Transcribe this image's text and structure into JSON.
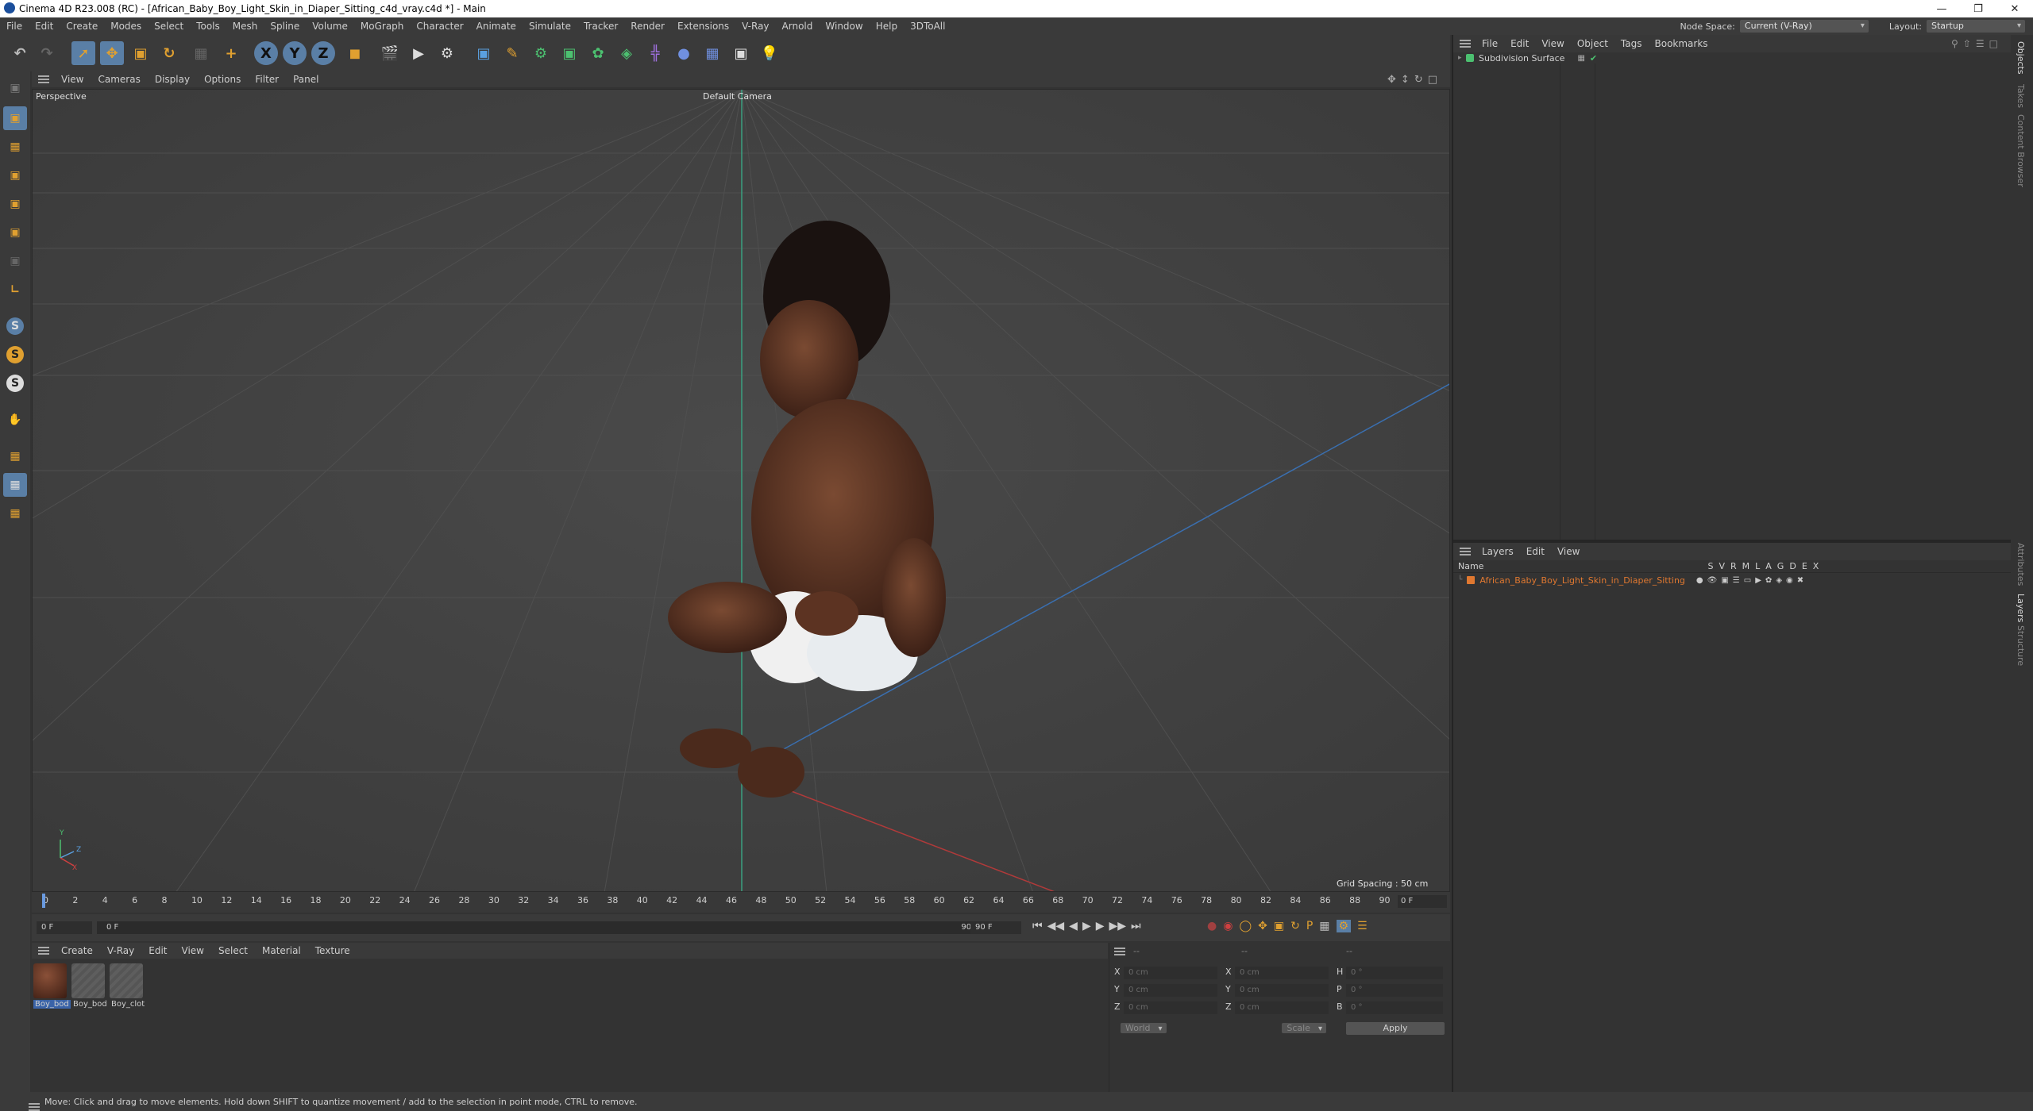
{
  "window": {
    "title": "Cinema 4D R23.008 (RC) - [African_Baby_Boy_Light_Skin_in_Diaper_Sitting_c4d_vray.c4d *] - Main"
  },
  "menubar": {
    "items": [
      "File",
      "Edit",
      "Create",
      "Modes",
      "Select",
      "Tools",
      "Mesh",
      "Spline",
      "Volume",
      "MoGraph",
      "Character",
      "Animate",
      "Simulate",
      "Tracker",
      "Render",
      "Extensions",
      "V-Ray",
      "Arnold",
      "Window",
      "Help",
      "3DToAll"
    ],
    "node_space_label": "Node Space:",
    "node_space_value": "Current (V-Ray)",
    "layout_label": "Layout:",
    "layout_value": "Startup"
  },
  "viewport": {
    "menu": [
      "View",
      "Cameras",
      "Display",
      "Options",
      "Filter",
      "Panel"
    ],
    "mode_label": "Perspective",
    "camera_label": "Default Camera",
    "grid_spacing": "Grid Spacing : 50 cm",
    "axis_labels": {
      "y": "Y",
      "z": "Z",
      "x": "X"
    }
  },
  "timeline": {
    "ticks": [
      "0",
      "2",
      "4",
      "6",
      "8",
      "10",
      "12",
      "14",
      "16",
      "18",
      "20",
      "22",
      "24",
      "26",
      "28",
      "30",
      "32",
      "34",
      "36",
      "38",
      "40",
      "42",
      "44",
      "46",
      "48",
      "50",
      "52",
      "54",
      "56",
      "58",
      "60",
      "62",
      "64",
      "66",
      "68",
      "70",
      "72",
      "74",
      "76",
      "78",
      "80",
      "82",
      "84",
      "86",
      "88",
      "90"
    ],
    "end_frame_field": "0 F"
  },
  "playbar": {
    "current_frame": "0 F",
    "start_frame": "0 F",
    "end_frame_a": "90 F",
    "end_frame_b": "90 F"
  },
  "material_manager": {
    "menu": [
      "Create",
      "V-Ray",
      "Edit",
      "View",
      "Select",
      "Material",
      "Texture"
    ],
    "materials": [
      {
        "label": "Boy_bod",
        "color": "#5a3325"
      },
      {
        "label": "Boy_bod",
        "color": "#555555"
      },
      {
        "label": "Boy_clot",
        "color": "#555555"
      }
    ]
  },
  "coordinates": {
    "header_a": "--",
    "header_b": "--",
    "header_c": "--",
    "rows": [
      {
        "axis": "X",
        "pos": "0 cm",
        "axis2": "X",
        "size": "0 cm",
        "rot_label": "H",
        "rot": "0 °"
      },
      {
        "axis": "Y",
        "pos": "0 cm",
        "axis2": "Y",
        "size": "0 cm",
        "rot_label": "P",
        "rot": "0 °"
      },
      {
        "axis": "Z",
        "pos": "0 cm",
        "axis2": "Z",
        "size": "0 cm",
        "rot_label": "B",
        "rot": "0 °"
      }
    ],
    "space_value": "World",
    "mode_value": "Scale",
    "apply_label": "Apply"
  },
  "objects_panel": {
    "menu": [
      "File",
      "Edit",
      "View",
      "Object",
      "Tags",
      "Bookmarks"
    ],
    "items": [
      {
        "name": "Subdivision Surface"
      }
    ]
  },
  "layers_panel": {
    "menu": [
      "Layers",
      "Edit",
      "View"
    ],
    "name_header": "Name",
    "flags": [
      "S",
      "V",
      "R",
      "M",
      "L",
      "A",
      "G",
      "D",
      "E",
      "X"
    ],
    "layers": [
      {
        "name": "African_Baby_Boy_Light_Skin_in_Diaper_Sitting",
        "color": "#e07830"
      }
    ]
  },
  "side_tabs": [
    "Objects",
    "Takes",
    "Content Browser",
    "Attributes",
    "Layers",
    "Structure"
  ],
  "status": {
    "text": "Move: Click and drag to move elements. Hold down SHIFT to quantize movement / add to the selection in point mode, CTRL to remove."
  },
  "colors": {
    "accent_blue": "#4a8fd8",
    "layer_orange": "#e07830",
    "selection_orange": "#e08a2e"
  }
}
